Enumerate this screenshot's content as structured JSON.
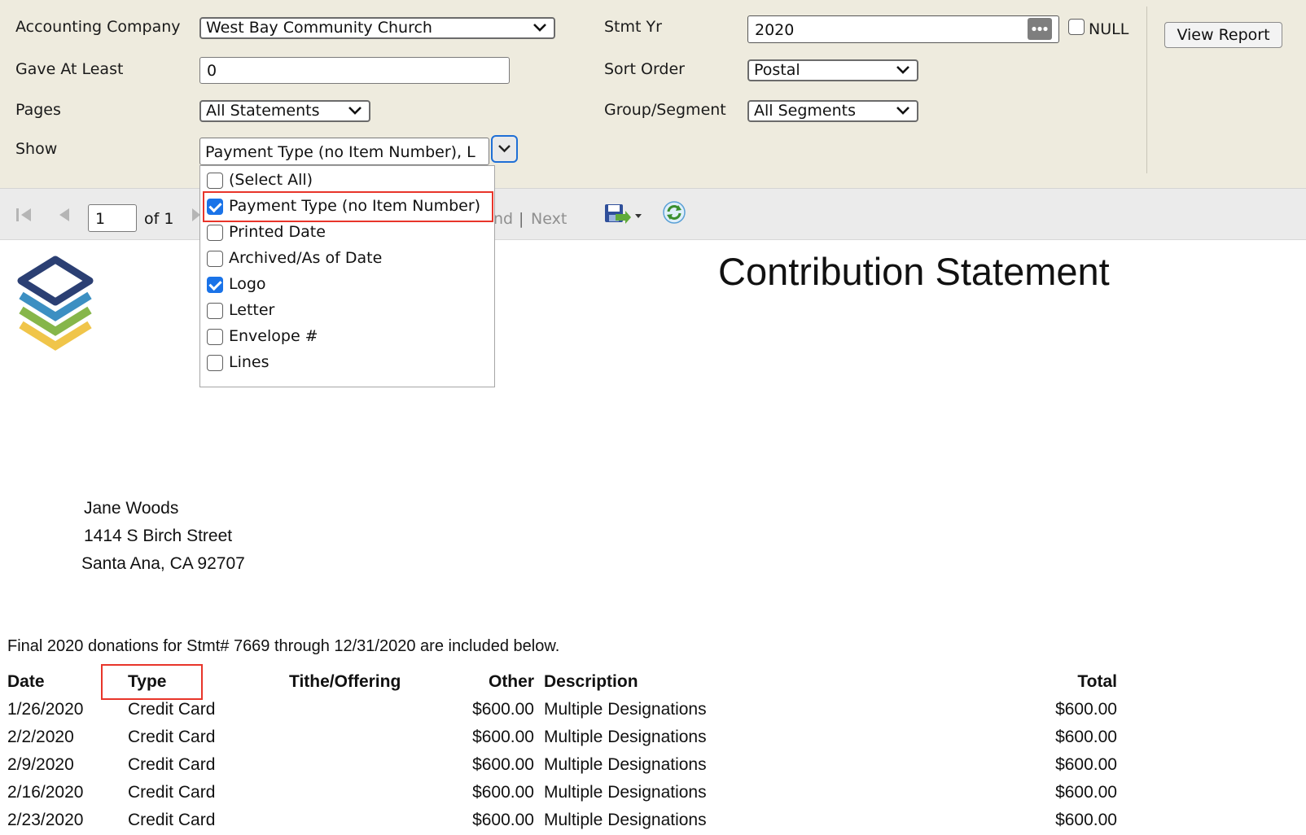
{
  "params": {
    "accounting_company": {
      "label": "Accounting Company",
      "value": "West Bay Community Church"
    },
    "gave_at_least": {
      "label": "Gave At Least",
      "value": "0"
    },
    "pages": {
      "label": "Pages",
      "value": "All Statements"
    },
    "show": {
      "label": "Show",
      "value": "Payment Type (no Item Number), L"
    },
    "stmt_yr": {
      "label": "Stmt Yr",
      "value": "2020",
      "null_label": "NULL"
    },
    "sort_order": {
      "label": "Sort Order",
      "value": "Postal"
    },
    "group_segment": {
      "label": "Group/Segment",
      "value": "All Segments"
    },
    "view_report_label": "View Report"
  },
  "show_options": [
    {
      "label": "(Select All)",
      "checked": false
    },
    {
      "label": "Payment Type (no Item Number)",
      "checked": true
    },
    {
      "label": "Printed Date",
      "checked": false
    },
    {
      "label": "Archived/As of Date",
      "checked": false
    },
    {
      "label": "Logo",
      "checked": true
    },
    {
      "label": "Letter",
      "checked": false
    },
    {
      "label": "Envelope #",
      "checked": false
    },
    {
      "label": "Lines",
      "checked": false
    }
  ],
  "toolbar": {
    "page_value": "1",
    "of_label": "of 1",
    "find_partial": "nd",
    "separator": "|",
    "next_label": "Next"
  },
  "report": {
    "title": "Contribution Statement",
    "address": [
      "Jane Woods",
      "1414 S Birch Street",
      "Santa Ana, CA 92707"
    ],
    "intro": "Final 2020 donations for Stmt# 7669 through 12/31/2020 are included below.",
    "columns": {
      "date": "Date",
      "type": "Type",
      "tithe": "Tithe/Offering",
      "other": "Other",
      "description": "Description",
      "total": "Total"
    },
    "rows": [
      {
        "date": "1/26/2020",
        "type": "Credit Card",
        "other": "$600.00",
        "description": "Multiple Designations",
        "total": "$600.00"
      },
      {
        "date": "2/2/2020",
        "type": "Credit Card",
        "other": "$600.00",
        "description": "Multiple Designations",
        "total": "$600.00"
      },
      {
        "date": "2/9/2020",
        "type": "Credit Card",
        "other": "$600.00",
        "description": "Multiple Designations",
        "total": "$600.00"
      },
      {
        "date": "2/16/2020",
        "type": "Credit Card",
        "other": "$600.00",
        "description": "Multiple Designations",
        "total": "$600.00"
      },
      {
        "date": "2/23/2020",
        "type": "Credit Card",
        "other": "$600.00",
        "description": "Multiple Designations",
        "total": "$600.00"
      }
    ]
  },
  "colors": {
    "param_bg": "#eeebde",
    "highlight": "#e8352a",
    "check_blue": "#1a73e8",
    "logo_navy": "#2b3f73",
    "logo_blue": "#3c8fc2",
    "logo_green": "#86b64a",
    "logo_yellow": "#f0c54a"
  }
}
